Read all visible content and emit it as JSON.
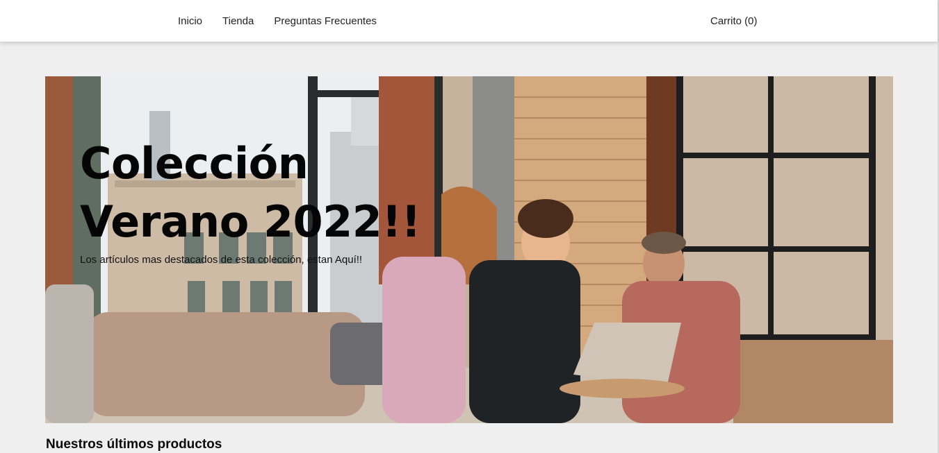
{
  "nav": {
    "items": [
      {
        "label": "Inicio"
      },
      {
        "label": "Tienda"
      },
      {
        "label": "Preguntas Frecuentes"
      }
    ],
    "cart_label": "Carrito (0)"
  },
  "hero": {
    "title": "Colección Verano 2022!!",
    "subtitle": "Los artículos mas destacados de esta colección, estan Aquí!!"
  },
  "products": {
    "section_title": "Nuestros últimos productos"
  }
}
